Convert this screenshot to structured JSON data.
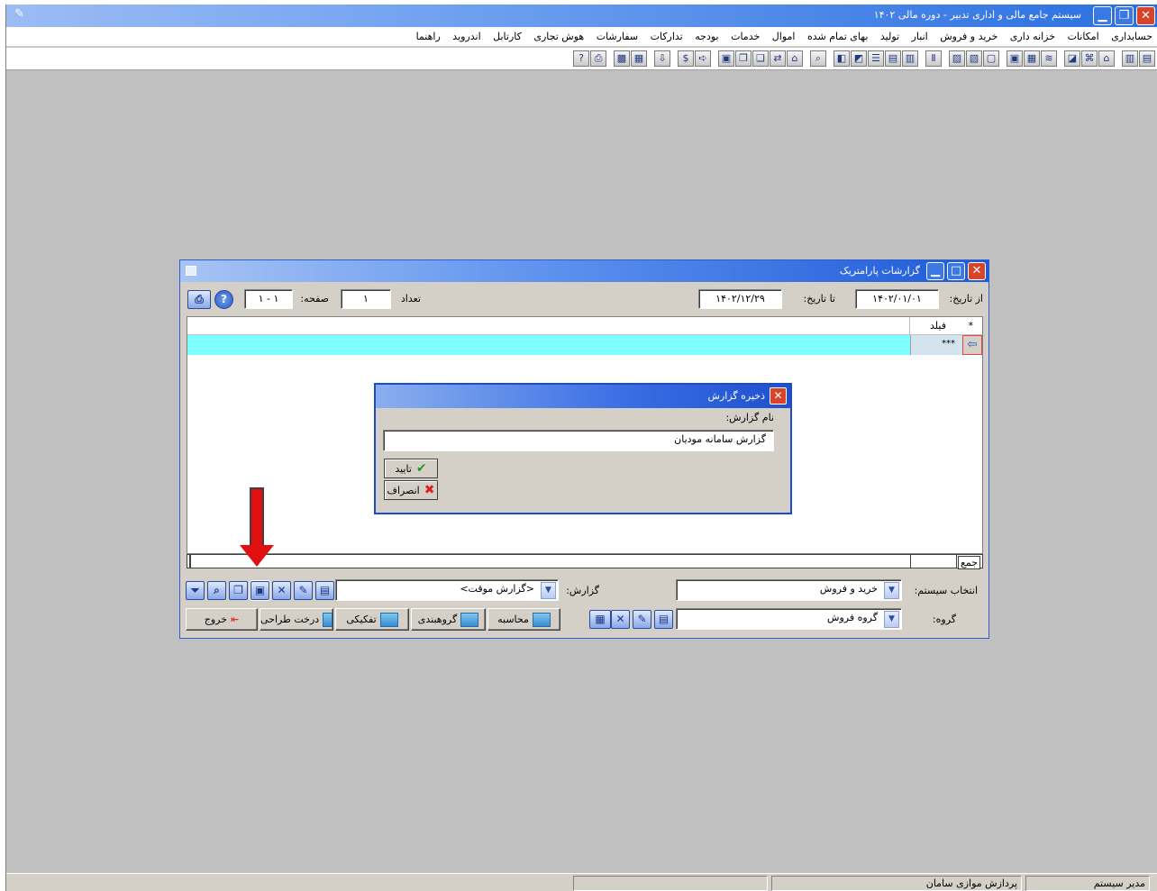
{
  "window": {
    "title": "سیستم جامع مالی و اداری تدبیر - دوره مالی ۱۴۰۲"
  },
  "menu": [
    "حسابداری",
    "امکانات",
    "خزانه داری",
    "خرید و فروش",
    "انبار",
    "تولید",
    "بهای تمام شده",
    "اموال",
    "خدمات",
    "بودجه",
    "تدارکات",
    "سفارشات",
    "هوش تجاری",
    "کارتابل",
    "اندروید",
    "راهنما"
  ],
  "report_window": {
    "title": "گزارشات پارامتریک",
    "from_date_label": "از تاریخ:",
    "from_date": "۱۴۰۲/۰۱/۰۱",
    "to_date_label": "تا تاریخ:",
    "to_date": "۱۴۰۲/۱۲/۲۹",
    "count_label": "تعداد",
    "count_value": "۱",
    "page_label": "صفحه:",
    "page_value": "۱ - ۱",
    "grid": {
      "header_star": "*",
      "header_field": "فیلد",
      "row_field": "***"
    },
    "sum_label": "جمع",
    "system_label": "انتخاب سیستم:",
    "system_value": "خرید و فروش",
    "report_label": "گزارش:",
    "report_value": "<گزارش موقت>",
    "group_label": "گروه:",
    "group_value": "گروه فروش",
    "buttons": {
      "calc": "محاسبه",
      "grouping": "گروهبندی",
      "breakdown": "تفکیکی",
      "design_tree": "درخت طراحی",
      "exit": "خروج"
    }
  },
  "save_dialog": {
    "title": "ذخیره گزارش",
    "name_label": "نام گزارش:",
    "name_value": "گزارش سامانه مودیان",
    "ok": "تایید",
    "cancel": "انصراف"
  },
  "statusbar": {
    "user": "مدیر سیستم",
    "company": "پردازش موازی سامان"
  },
  "colors": {
    "title_blue": "#2a6fe0",
    "grid_highlight": "#80ffff",
    "arrow_red": "#e01010"
  }
}
